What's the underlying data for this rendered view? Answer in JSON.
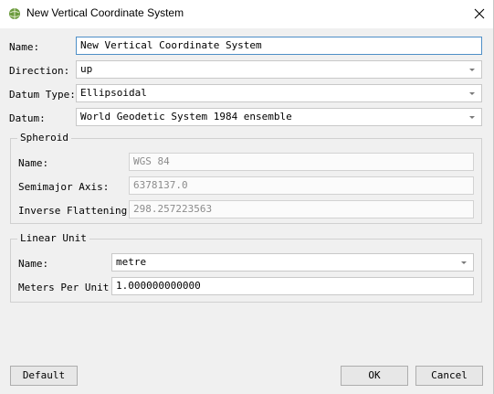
{
  "window": {
    "title": "New Vertical Coordinate System",
    "icon": "qgis-globe-icon",
    "close_icon": "close-icon"
  },
  "form": {
    "name_label": "Name:",
    "name_value": "New Vertical Coordinate System",
    "direction_label": "Direction:",
    "direction_value": "up",
    "datum_type_label": "Datum Type:",
    "datum_type_value": "Ellipsoidal",
    "datum_label": "Datum:",
    "datum_value": "World Geodetic System 1984 ensemble"
  },
  "spheroid": {
    "title": "Spheroid",
    "name_label": "Name:",
    "name_value": "WGS 84",
    "semimajor_label": "Semimajor Axis:",
    "semimajor_value": "6378137.0",
    "flattening_label": "Inverse Flattening:",
    "flattening_value": "298.257223563"
  },
  "linear_unit": {
    "title": "Linear Unit",
    "name_label": "Name:",
    "name_value": "metre",
    "meters_label": "Meters Per Unit:",
    "meters_value": "1.000000000000"
  },
  "buttons": {
    "default": "Default",
    "ok": "OK",
    "cancel": "Cancel"
  },
  "colors": {
    "focus_border": "#4e8fc7",
    "dialog_bg": "#f0f0f0"
  }
}
